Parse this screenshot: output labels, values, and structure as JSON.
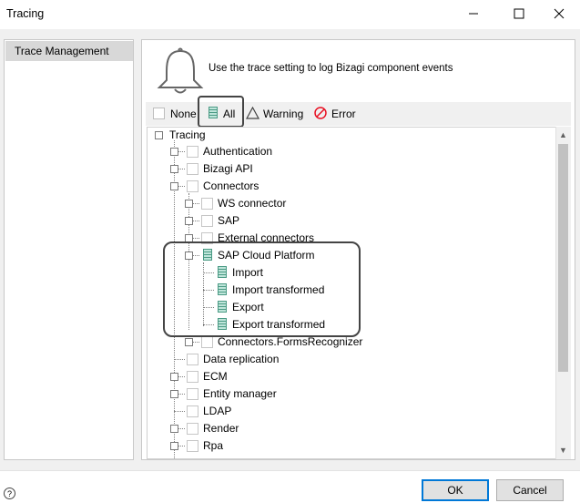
{
  "window": {
    "title": "Tracing"
  },
  "sidebar": {
    "items": [
      {
        "label": "Trace Management",
        "selected": true
      }
    ]
  },
  "main": {
    "description": "Use the trace setting to log Bizagi component events",
    "header_icon": "bell-icon",
    "filters": [
      {
        "label": "None",
        "icon": "empty-checkbox-icon"
      },
      {
        "label": "All",
        "icon": "all-level-icon",
        "highlighted": true
      },
      {
        "label": "Warning",
        "icon": "warning-triangle-icon"
      },
      {
        "label": "Error",
        "icon": "error-circle-icon",
        "color": "#e81123"
      }
    ]
  },
  "tree": {
    "root": "Tracing",
    "items": {
      "authentication": "Authentication",
      "bizagi_api": "Bizagi API",
      "connectors": "Connectors",
      "ws_connector": "WS connector",
      "sap": "SAP",
      "external_connectors": "External connectors",
      "sap_cloud_platform": "SAP Cloud Platform",
      "import": "Import",
      "import_transformed": "Import transformed",
      "export": "Export",
      "export_transformed": "Export transformed",
      "connectors_forms_recognizer": "Connectors.FormsRecognizer",
      "data_replication": "Data replication",
      "ecm": "ECM",
      "entity_manager": "Entity manager",
      "ldap": "LDAP",
      "render": "Render",
      "rpa": "Rpa"
    }
  },
  "buttons": {
    "ok": "OK",
    "cancel": "Cancel"
  },
  "help_icon": "help-icon",
  "colors": {
    "accent": "#0078d7",
    "all_level": "#4a9a84",
    "error": "#e81123"
  }
}
